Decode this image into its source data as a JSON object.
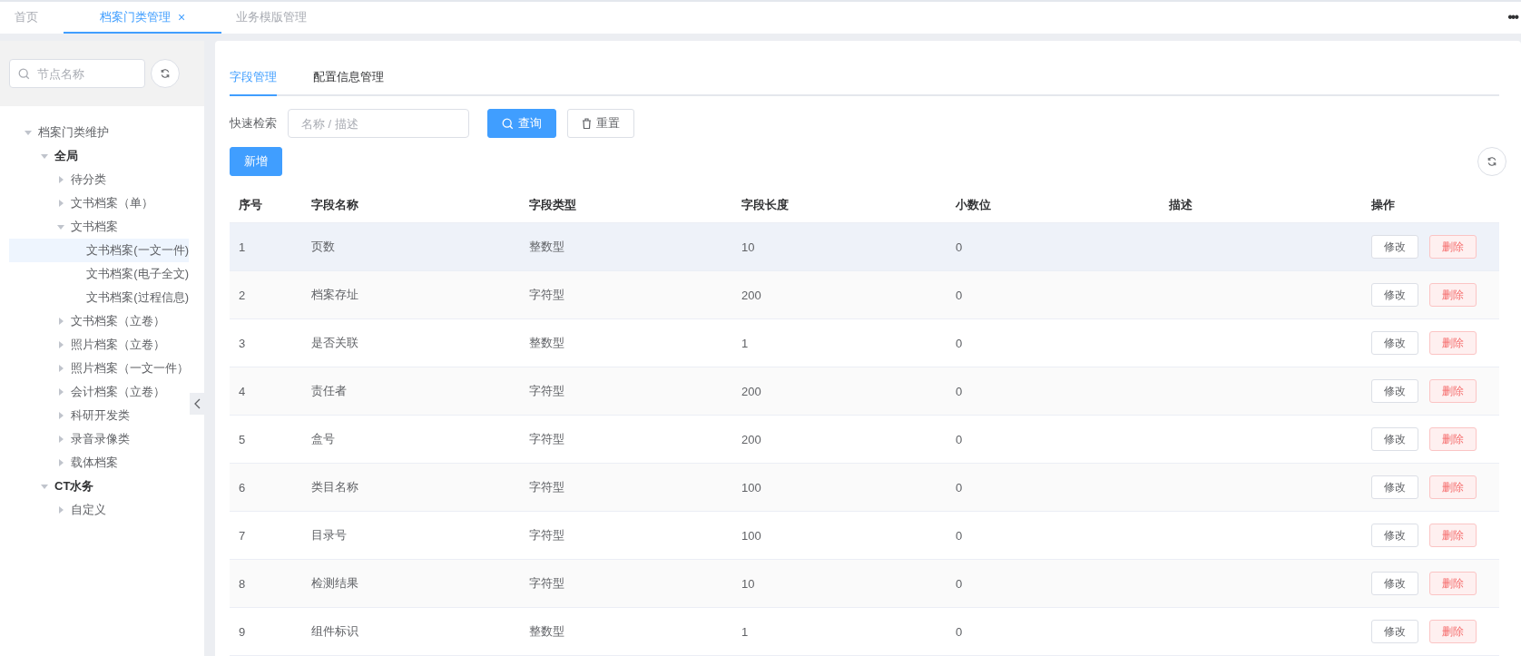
{
  "top_tabs": [
    {
      "label": "首页",
      "selected": false
    },
    {
      "label": "档案门类管理",
      "selected": true,
      "close": "×"
    },
    {
      "label": "业务模版管理",
      "selected": false
    }
  ],
  "more": "•••",
  "sidebar": {
    "search": {
      "placeholder": "节点名称"
    },
    "tree": [
      {
        "label": "档案门类维护",
        "expanded": true,
        "bold": false,
        "selected": false,
        "children": [
          {
            "label": "全局",
            "expanded": true,
            "bold": true,
            "selected": false,
            "children": [
              {
                "label": "待分类",
                "expanded": false,
                "bold": false,
                "selected": false
              },
              {
                "label": "文书档案（单）",
                "expanded": false,
                "bold": false,
                "selected": false
              },
              {
                "label": "文书档案",
                "expanded": true,
                "bold": false,
                "selected": false,
                "children": [
                  {
                    "label": "文书档案(一文一件)",
                    "bold": false,
                    "selected": true
                  },
                  {
                    "label": "文书档案(电子全文)",
                    "bold": false,
                    "selected": false
                  },
                  {
                    "label": "文书档案(过程信息)",
                    "bold": false,
                    "selected": false
                  }
                ]
              },
              {
                "label": "文书档案（立卷）",
                "expanded": false,
                "bold": false,
                "selected": false
              },
              {
                "label": "照片档案（立卷）",
                "expanded": false,
                "bold": false,
                "selected": false
              },
              {
                "label": "照片档案（一文一件）",
                "expanded": false,
                "bold": false,
                "selected": false
              },
              {
                "label": "会计档案（立卷）",
                "expanded": false,
                "bold": false,
                "selected": false
              },
              {
                "label": "科研开发类",
                "expanded": false,
                "bold": false,
                "selected": false
              },
              {
                "label": "录音录像类",
                "expanded": false,
                "bold": false,
                "selected": false
              },
              {
                "label": "载体档案",
                "expanded": false,
                "bold": false,
                "selected": false
              }
            ]
          },
          {
            "label": "CT水务",
            "expanded": true,
            "bold": true,
            "selected": false,
            "children": [
              {
                "label": "自定义",
                "expanded": false,
                "bold": false,
                "selected": false
              }
            ]
          }
        ]
      }
    ]
  },
  "main": {
    "tabs": [
      {
        "label": "字段管理",
        "selected": true
      },
      {
        "label": "配置信息管理",
        "selected": false
      }
    ],
    "search_label": "快速检索",
    "search": {
      "placeholder": "名称 / 描述"
    },
    "query_button": "查询",
    "reset_button": "重置",
    "add_button": "新增",
    "table": {
      "columns": [
        "序号",
        "字段名称",
        "字段类型",
        "字段长度",
        "小数位",
        "描述",
        "操作"
      ],
      "rows": [
        {
          "cells": [
            "1",
            "页数",
            "整数型",
            "10",
            "0",
            ""
          ],
          "actions": [
            "修改",
            "删除"
          ],
          "highlighted": true
        },
        {
          "cells": [
            "2",
            "档案存址",
            "字符型",
            "200",
            "0",
            ""
          ],
          "actions": [
            "修改",
            "删除"
          ],
          "highlighted": false
        },
        {
          "cells": [
            "3",
            "是否关联",
            "整数型",
            "1",
            "0",
            ""
          ],
          "actions": [
            "修改",
            "删除"
          ],
          "highlighted": false
        },
        {
          "cells": [
            "4",
            "责任者",
            "字符型",
            "200",
            "0",
            ""
          ],
          "actions": [
            "修改",
            "删除"
          ],
          "highlighted": false
        },
        {
          "cells": [
            "5",
            "盒号",
            "字符型",
            "200",
            "0",
            ""
          ],
          "actions": [
            "修改",
            "删除"
          ],
          "highlighted": false
        },
        {
          "cells": [
            "6",
            "类目名称",
            "字符型",
            "100",
            "0",
            ""
          ],
          "actions": [
            "修改",
            "删除"
          ],
          "highlighted": false
        },
        {
          "cells": [
            "7",
            "目录号",
            "字符型",
            "100",
            "0",
            ""
          ],
          "actions": [
            "修改",
            "删除"
          ],
          "highlighted": false
        },
        {
          "cells": [
            "8",
            "检测结果",
            "字符型",
            "10",
            "0",
            ""
          ],
          "actions": [
            "修改",
            "删除"
          ],
          "highlighted": false
        },
        {
          "cells": [
            "9",
            "组件标识",
            "整数型",
            "1",
            "0",
            ""
          ],
          "actions": [
            "修改",
            "删除"
          ],
          "highlighted": false
        }
      ]
    }
  }
}
